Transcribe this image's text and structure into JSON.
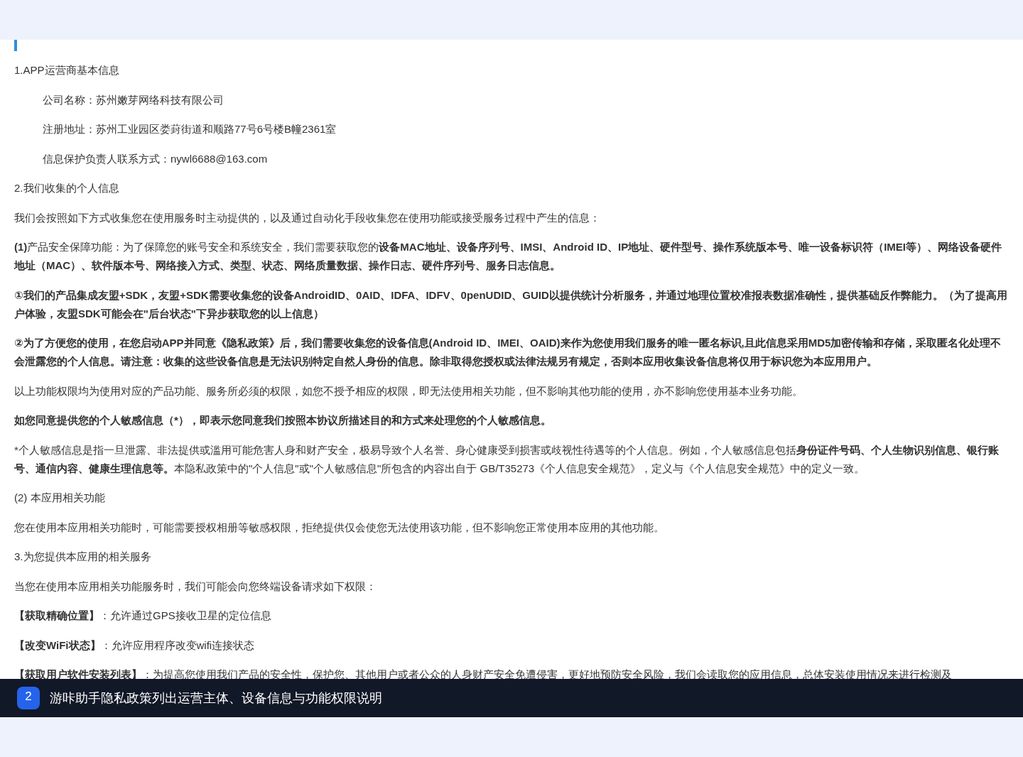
{
  "paragraphs": [
    {
      "kind": "text",
      "bold": false,
      "text": "1.APP运营商基本信息"
    },
    {
      "kind": "indented",
      "bold": false,
      "text": "公司名称：苏州嫩芽网络科技有限公司"
    },
    {
      "kind": "indented",
      "bold": false,
      "text": "注册地址：苏州工业园区娄葑街道和顺路77号6号楼B幢2361室"
    },
    {
      "kind": "indented",
      "bold": false,
      "text": "信息保护负责人联系方式：nywl6688@163.com"
    },
    {
      "kind": "text",
      "bold": false,
      "text": "2.我们收集的个人信息"
    },
    {
      "kind": "text",
      "bold": false,
      "text": "我们会按照如下方式收集您在使用服务时主动提供的，以及通过自动化手段收集您在使用功能或接受服务过程中产生的信息："
    },
    {
      "kind": "text",
      "bold": false,
      "text": "**(1)**产品安全保障功能：为了保障您的账号安全和系统安全，我们需要获取您的**设备MAC地址、设备序列号、IMSI、Android ID、IP地址、硬件型号、操作系统版本号、唯一设备标识符（IMEI等）、网络设备硬件地址（MAC）、软件版本号、网络接入方式、类型、状态、网络质量数据、操作日志、硬件序列号、服务日志信息。**"
    },
    {
      "kind": "text",
      "bold": true,
      "text": "①我们的产品集成友盟+SDK，友盟+SDK需要收集您的设备AndroidID、0AID、IDFA、IDFV、0penUDID、GUID以提供统计分析服务，并通过地理位置校准报表数据准确性，提供基础反作弊能力。（为了提高用户体验，友盟SDK可能会在\"后台状态\"下异步获取您的以上信息）"
    },
    {
      "kind": "text",
      "bold": true,
      "text": "②为了方便您的使用，在您启动APP并同意《隐私政策》后，我们需要收集您的设备信息(Android ID、IMEI、OAID)来作为您使用我们服务的唯一匿名标识,且此信息采用MD5加密传输和存储，采取匿名化处理不会泄露您的个人信息。请注意：收集的这些设备信息是无法识别特定自然人身份的信息。除非取得您授权或法律法规另有规定，否则本应用收集设备信息将仅用于标识您为本应用用户。"
    },
    {
      "kind": "text",
      "bold": false,
      "text": "以上功能权限均为使用对应的产品功能、服务所必须的权限，如您不授予相应的权限，即无法使用相关功能，但不影响其他功能的使用，亦不影响您使用基本业务功能。"
    },
    {
      "kind": "text",
      "bold": true,
      "text": "如您同意提供您的个人敏感信息（*），即表示您同意我们按照本协议所描述目的和方式来处理您的个人敏感信息。"
    },
    {
      "kind": "text",
      "bold": false,
      "text": "*个人敏感信息是指一旦泄露、非法提供或滥用可能危害人身和财产安全，极易导致个人名誉、身心健康受到损害或歧视性待遇等的个人信息。例如，个人敏感信息包括**身份证件号码、个人生物识别信息、银行账号、通信内容、健康生理信息等。**本隐私政策中的\"个人信息\"或\"个人敏感信息\"所包含的内容出自于 GB/T35273《个人信息安全规范》，定义与《个人信息安全规范》中的定义一致。"
    },
    {
      "kind": "text",
      "bold": false,
      "text": "(2) 本应用相关功能"
    },
    {
      "kind": "text",
      "bold": false,
      "text": "您在使用本应用相关功能时，可能需要授权相册等敏感权限，拒绝提供仅会使您无法使用该功能，但不影响您正常使用本应用的其他功能。"
    },
    {
      "kind": "text",
      "bold": false,
      "text": "3.为您提供本应用的相关服务"
    },
    {
      "kind": "text",
      "bold": false,
      "text": "当您在使用本应用相关功能服务时，我们可能会向您终端设备请求如下权限："
    },
    {
      "kind": "text",
      "bold": false,
      "text": "**【获取精确位置】**：允许通过GPS接收卫星的定位信息"
    },
    {
      "kind": "text",
      "bold": false,
      "text": "**【改变WiFi状态】**：允许应用程序改变wifi连接状态"
    },
    {
      "kind": "text",
      "bold": false,
      "text": "**【获取用户软件安装列表】**：为提高您使用我们产品的安全性，保护您、其他用户或者公众的人身财产安全免遭侵害，更好地预防安全风险，我们会读取您的应用信息，总体安装使用情况来进行检测及"
    }
  ],
  "caption": {
    "number": "2",
    "text": "游咔助手隐私政策列出运营主体、设备信息与功能权限说明"
  }
}
